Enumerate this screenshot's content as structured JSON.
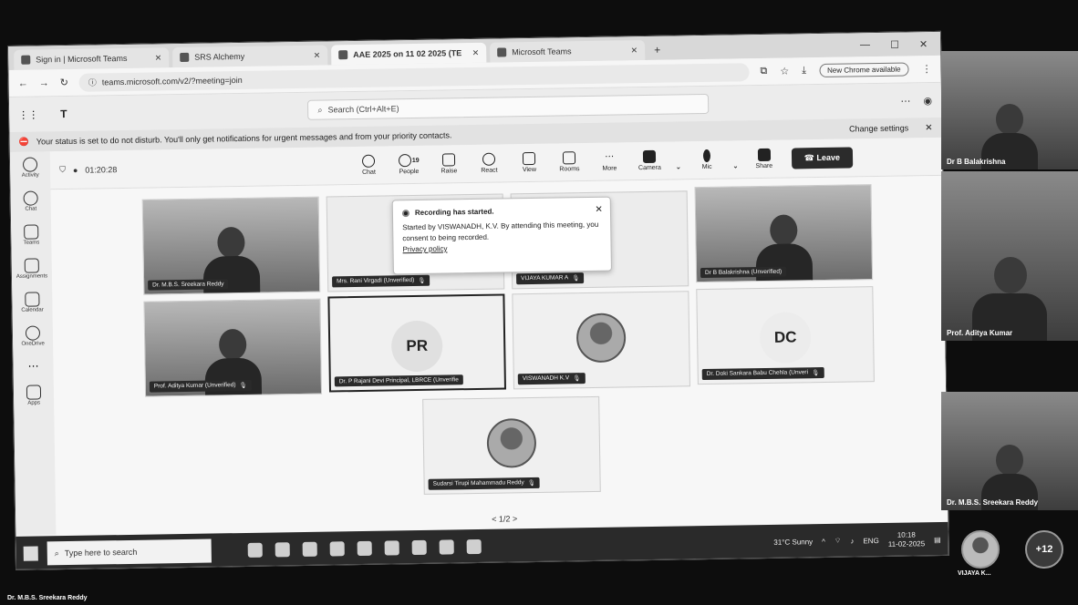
{
  "browser": {
    "tabs": [
      {
        "label": "Sign in | Microsoft Teams"
      },
      {
        "label": "SRS Alchemy"
      },
      {
        "label": "AAE 2025 on 11 02 2025 (TE"
      },
      {
        "label": "Microsoft Teams"
      }
    ],
    "url": "teams.microsoft.com/v2/?meeting=join",
    "profile_label": "New Chrome available"
  },
  "teams": {
    "search_placeholder": "Search (Ctrl+Alt+E)"
  },
  "banner": {
    "text": "Your status is set to do not disturb. You'll only get notifications for urgent messages and from your priority contacts.",
    "link": "Change settings"
  },
  "rail": [
    {
      "label": "Activity"
    },
    {
      "label": "Chat"
    },
    {
      "label": "Teams"
    },
    {
      "label": "Assignments"
    },
    {
      "label": "Calendar"
    },
    {
      "label": "OneDrive"
    },
    {
      "label": "Apps"
    }
  ],
  "meeting": {
    "timer": "01:20:28",
    "people_count": "19",
    "toolbar": [
      {
        "label": "Chat"
      },
      {
        "label": "People"
      },
      {
        "label": "Raise"
      },
      {
        "label": "React"
      },
      {
        "label": "View"
      },
      {
        "label": "Rooms"
      },
      {
        "label": "More"
      },
      {
        "label": "Camera"
      },
      {
        "label": "Mic"
      },
      {
        "label": "Share"
      }
    ],
    "leave_label": "Leave"
  },
  "tiles": [
    {
      "name": "Dr. M.B.S. Sreekara Reddy"
    },
    {
      "name": "Mrs. Rani Virgadi (Unverified)"
    },
    {
      "name": "VIJAYA KUMAR A"
    },
    {
      "name": "Dr B Balakrishna (Unverified)"
    },
    {
      "name": "Prof. Aditya Kumar (Unverified)"
    },
    {
      "name": "Dr. P Rajani Devi Principal, LBRCE (Unverifie",
      "initials": "PR"
    },
    {
      "name": "VISWANADH K.V"
    },
    {
      "name": "Dr. Doki Sankara Babu Chehla (Unveri",
      "initials": "DC"
    },
    {
      "name": "Sudarsi Tirupi Mahammadu Reddy"
    }
  ],
  "pager": "< 1/2 >",
  "toast": {
    "title": "Recording has started.",
    "body": "Started by VISWANADH, K.V. By attending this meeting, you consent to being recorded.",
    "link": "Privacy policy"
  },
  "taskbar": {
    "search_placeholder": "Type here to search",
    "weather": "31°C Sunny",
    "language": "ENG",
    "time": "10:18",
    "date": "11-02-2025"
  },
  "side_gallery": [
    {
      "name": "Dr B Balakrishna"
    },
    {
      "name": "Prof. Aditya Kumar"
    },
    {
      "name": "Dr. M.B.S. Sreekara Reddy"
    },
    {
      "name": "VIJAYA K..."
    },
    {
      "name": "+12"
    }
  ],
  "footer_name": "Dr. M.B.S. Sreekara Reddy"
}
